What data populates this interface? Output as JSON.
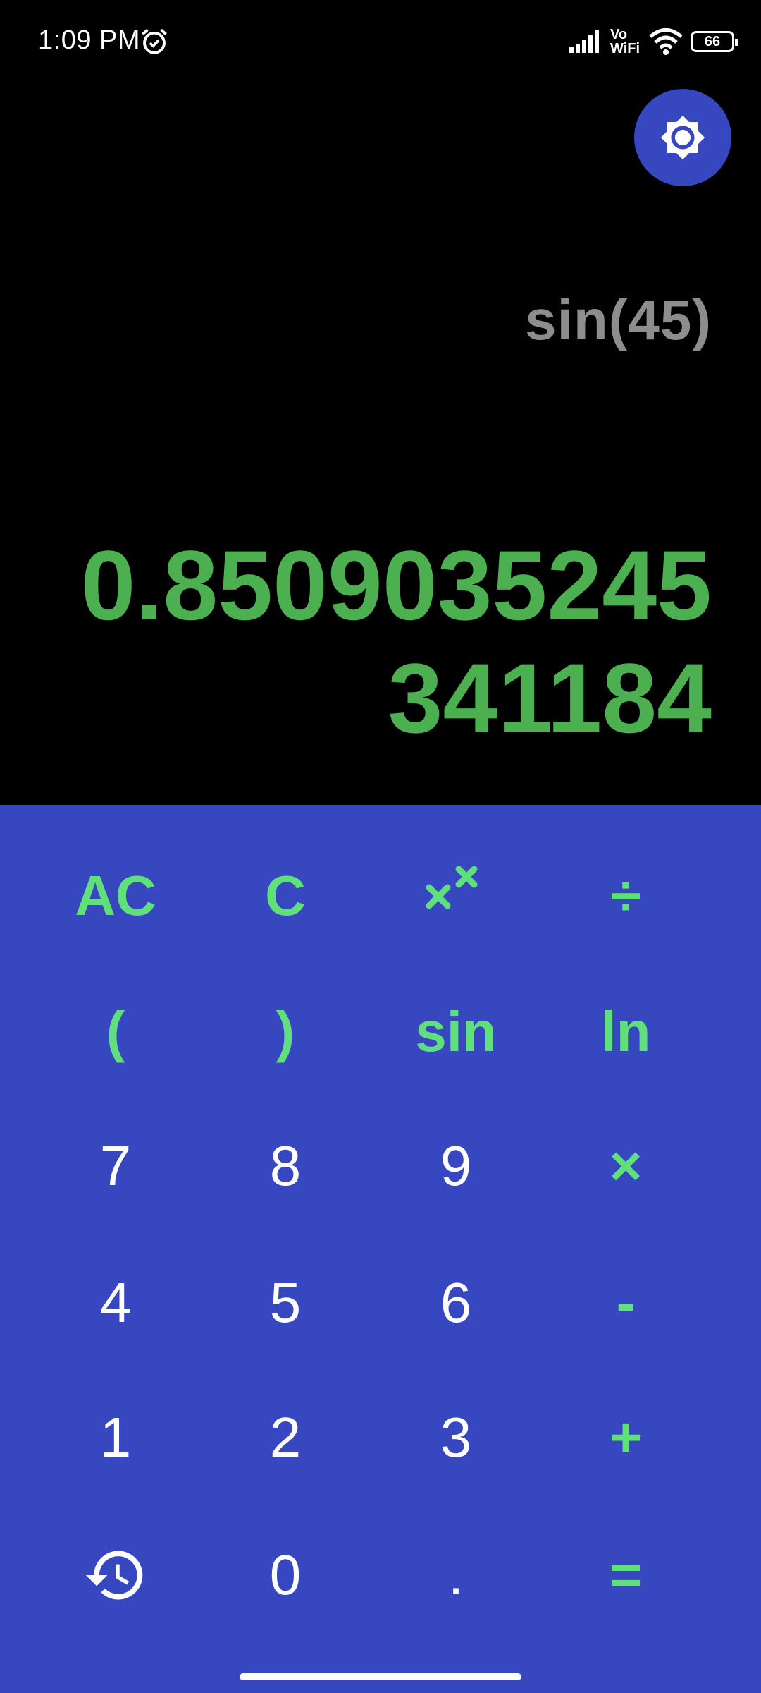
{
  "status_bar": {
    "time": "1:09 PM",
    "vowifi_top": "Vo",
    "vowifi_bottom": "WiFi",
    "battery": "66"
  },
  "display": {
    "expression": "sin(45)",
    "result": "0.8509035245341184"
  },
  "keypad": {
    "row1": [
      "AC",
      "C",
      "x^x",
      "÷"
    ],
    "row2": [
      "(",
      ")",
      "sin",
      "ln"
    ],
    "row3": [
      "7",
      "8",
      "9",
      "×"
    ],
    "row4": [
      "4",
      "5",
      "6",
      "-"
    ],
    "row5": [
      "1",
      "2",
      "3",
      "+"
    ],
    "row6": [
      "history-icon",
      "0",
      ".",
      "="
    ]
  },
  "colors": {
    "background": "#000000",
    "keypad": "#3747c0",
    "accent_green": "#5fe07a",
    "result_green": "#4caf50",
    "expression_gray": "#8d8d8d"
  }
}
